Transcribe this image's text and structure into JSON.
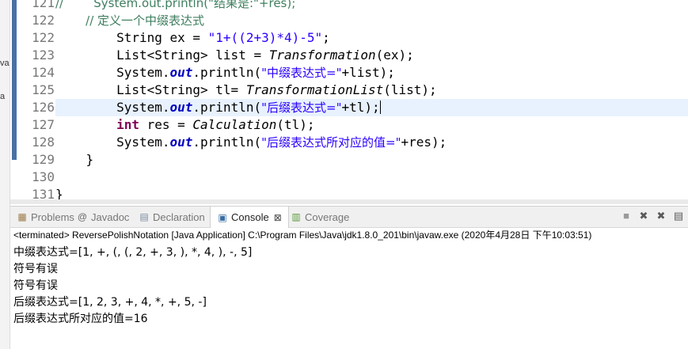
{
  "left_strip": {
    "frag1": "va",
    "frag2": "a"
  },
  "editor": {
    "lines": [
      {
        "num": "121",
        "segs": [
          {
            "t": "//        System.out.println(\"结果是:\"+res);",
            "c": "cmt"
          }
        ]
      },
      {
        "num": "122",
        "segs": [
          {
            "t": "        // 定义一个中缀表达式",
            "c": "cmt"
          }
        ]
      },
      {
        "num": "122",
        "segs": [
          {
            "t": "        String ex = ",
            "c": ""
          },
          {
            "t": "\"1+((2+3)*4)-5\"",
            "c": "str"
          },
          {
            "t": ";",
            "c": ""
          }
        ]
      },
      {
        "num": "123",
        "segs": [
          {
            "t": "        List<String> list = ",
            "c": ""
          },
          {
            "t": "Transformation",
            "c": "it"
          },
          {
            "t": "(ex);",
            "c": ""
          }
        ]
      },
      {
        "num": "124",
        "segs": [
          {
            "t": "        System.",
            "c": ""
          },
          {
            "t": "out",
            "c": "fld"
          },
          {
            "t": ".println(",
            "c": ""
          },
          {
            "t": "\"中缀表达式=\"",
            "c": "str"
          },
          {
            "t": "+list);",
            "c": ""
          }
        ]
      },
      {
        "num": "125",
        "segs": [
          {
            "t": "        List<String> tl= ",
            "c": ""
          },
          {
            "t": "TransformationList",
            "c": "it"
          },
          {
            "t": "(list);",
            "c": ""
          }
        ]
      },
      {
        "num": "126",
        "segs": [
          {
            "t": "        System.",
            "c": ""
          },
          {
            "t": "out",
            "c": "fld"
          },
          {
            "t": ".println(",
            "c": ""
          },
          {
            "t": "\"后缀表达式=\"",
            "c": "str"
          },
          {
            "t": "+tl);",
            "c": ""
          }
        ]
      },
      {
        "num": "127",
        "segs": [
          {
            "t": "        ",
            "c": ""
          },
          {
            "t": "int",
            "c": "kw"
          },
          {
            "t": " res = ",
            "c": ""
          },
          {
            "t": "Calculation",
            "c": "it"
          },
          {
            "t": "(tl);",
            "c": ""
          }
        ]
      },
      {
        "num": "128",
        "segs": [
          {
            "t": "        System.",
            "c": ""
          },
          {
            "t": "out",
            "c": "fld"
          },
          {
            "t": ".println(",
            "c": ""
          },
          {
            "t": "\"后缀表达式所对应的值=\"",
            "c": "str"
          },
          {
            "t": "+res);",
            "c": ""
          }
        ]
      },
      {
        "num": "129",
        "segs": [
          {
            "t": "    }",
            "c": ""
          }
        ]
      },
      {
        "num": "130",
        "segs": [
          {
            "t": "",
            "c": ""
          }
        ]
      },
      {
        "num": "131",
        "segs": [
          {
            "t": "}",
            "c": ""
          }
        ]
      }
    ],
    "current_line_index": 6
  },
  "views": {
    "tabs": [
      {
        "label": "Problems",
        "icon": "problems-icon",
        "glyph": "▦",
        "color": "#9b7b4a",
        "active": false
      },
      {
        "label": "Javadoc",
        "icon": "javadoc-icon",
        "glyph": "@",
        "color": "#666666",
        "active": false
      },
      {
        "label": "Declaration",
        "icon": "declaration-icon",
        "glyph": "▤",
        "color": "#7a8aa0",
        "active": false
      },
      {
        "label": "Console",
        "icon": "console-icon",
        "glyph": "▣",
        "color": "#3a6ea5",
        "active": true,
        "close": "⊠"
      },
      {
        "label": "Coverage",
        "icon": "coverage-icon",
        "glyph": "▥",
        "color": "#5a9a3a",
        "active": false
      }
    ],
    "toolbar": [
      {
        "name": "terminate-icon",
        "glyph": "■",
        "color": "#9a9a9a"
      },
      {
        "name": "remove-launch-icon",
        "glyph": "✖",
        "color": "#5a5a5a"
      },
      {
        "name": "remove-all-terminated-icon",
        "glyph": "✖",
        "color": "#5a5a5a"
      },
      {
        "name": "clear-console-icon",
        "glyph": "▤",
        "color": "#5a5a5a"
      }
    ]
  },
  "console": {
    "launch_info": "<terminated> ReversePolishNotation [Java Application] C:\\Program Files\\Java\\jdk1.8.0_201\\bin\\javaw.exe (2020年4月28日 下午10:03:51)",
    "output": [
      "中缀表达式=[1, +, (, (, 2, +, 3, ), *, 4, ), -, 5]",
      "符号有误",
      "符号有误",
      "后缀表达式=[1, 2, 3, +, 4, *, +, 5, -]",
      "后缀表达式所对应的值=16"
    ]
  }
}
